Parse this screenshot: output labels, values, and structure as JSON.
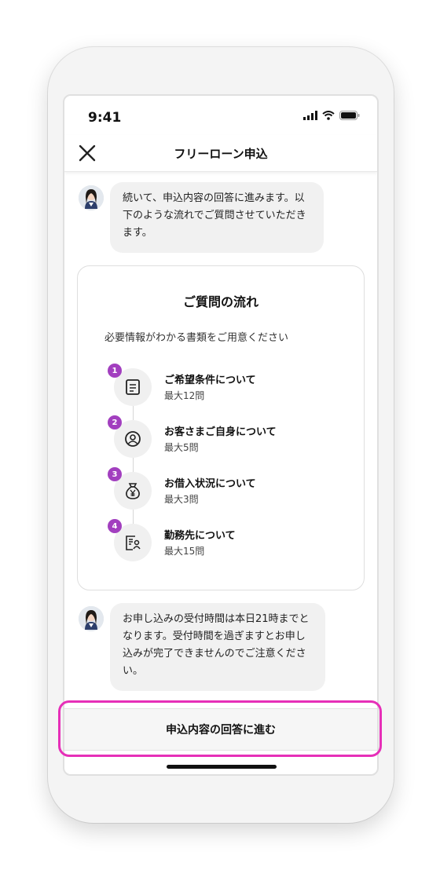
{
  "status_bar": {
    "time": "9:41"
  },
  "nav": {
    "title": "フリーローン申込"
  },
  "messages": [
    {
      "text": "続いて、申込内容の回答に進みます。以下のような流れでご質問させていただきます。"
    },
    {
      "text": "お申し込みの受付時間は本日21時までとなります。受付時間を過ぎますとお申し込みが完了できませんのでご注意ください。"
    }
  ],
  "flow_card": {
    "title": "ご質問の流れ",
    "subtitle": "必要情報がわかる書類をご用意ください",
    "steps": [
      {
        "number": "1",
        "title": "ご希望条件について",
        "sub": "最大12問",
        "icon": "document-icon"
      },
      {
        "number": "2",
        "title": "お客さまご自身について",
        "sub": "最大5問",
        "icon": "person-icon"
      },
      {
        "number": "3",
        "title": "お借入状況について",
        "sub": "最大3問",
        "icon": "yen-bag-icon"
      },
      {
        "number": "4",
        "title": "勤務先について",
        "sub": "最大15問",
        "icon": "employment-doc-icon"
      }
    ]
  },
  "cta": {
    "label": "申込内容の回答に進む"
  },
  "colors": {
    "step_badge": "#a23fbf",
    "highlight": "#e62fb8"
  }
}
